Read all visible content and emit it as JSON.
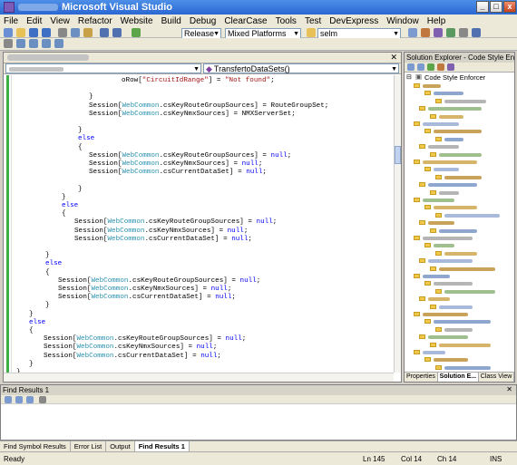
{
  "window": {
    "title": "Microsoft Visual Studio"
  },
  "menu": [
    "File",
    "Edit",
    "View",
    "Refactor",
    "Website",
    "Build",
    "Debug",
    "ClearCase",
    "Tools",
    "Test",
    "DevExpress",
    "Window",
    "Help"
  ],
  "toolbar": {
    "config": "Release",
    "platform": "Mixed Platforms",
    "find_text": "selm"
  },
  "editor": {
    "member_combo": "TransfertoDataSets()"
  },
  "code_lines": [
    {
      "indent": 156,
      "parts": [
        [
          "n",
          "oRow["
        ],
        [
          "s",
          "\"CircuitIdRange\""
        ],
        [
          "n",
          "] = "
        ],
        [
          "s",
          "\"Not found\""
        ],
        [
          "n",
          ";"
        ]
      ]
    },
    {
      "indent": 120,
      "parts": [
        [
          "n",
          ""
        ]
      ]
    },
    {
      "indent": 120,
      "parts": [
        [
          "n",
          "}"
        ]
      ]
    },
    {
      "indent": 120,
      "parts": [
        [
          "n",
          "Session["
        ],
        [
          "t",
          "WebCommon"
        ],
        [
          "n",
          ".csKeyRouteGroupSources] = RouteGroupSet;"
        ]
      ]
    },
    {
      "indent": 120,
      "parts": [
        [
          "n",
          "Session["
        ],
        [
          "t",
          "WebCommon"
        ],
        [
          "n",
          ".csKeyNmxSources] = NMXServerSet;"
        ]
      ]
    },
    {
      "indent": 120,
      "parts": [
        [
          "n",
          ""
        ]
      ]
    },
    {
      "indent": 108,
      "parts": [
        [
          "n",
          "}"
        ]
      ]
    },
    {
      "indent": 108,
      "parts": [
        [
          "k",
          "else"
        ]
      ]
    },
    {
      "indent": 108,
      "parts": [
        [
          "n",
          "{"
        ]
      ]
    },
    {
      "indent": 120,
      "parts": [
        [
          "n",
          "Session["
        ],
        [
          "t",
          "WebCommon"
        ],
        [
          "n",
          ".csKeyRouteGroupSources] = "
        ],
        [
          "k",
          "null"
        ],
        [
          "n",
          ";"
        ]
      ]
    },
    {
      "indent": 120,
      "parts": [
        [
          "n",
          "Session["
        ],
        [
          "t",
          "WebCommon"
        ],
        [
          "n",
          ".csKeyNmxSources] = "
        ],
        [
          "k",
          "null"
        ],
        [
          "n",
          ";"
        ]
      ]
    },
    {
      "indent": 120,
      "parts": [
        [
          "n",
          "Session["
        ],
        [
          "t",
          "WebCommon"
        ],
        [
          "n",
          ".csCurrentDataSet] = "
        ],
        [
          "k",
          "null"
        ],
        [
          "n",
          ";"
        ]
      ]
    },
    {
      "indent": 120,
      "parts": [
        [
          "n",
          ""
        ]
      ]
    },
    {
      "indent": 108,
      "parts": [
        [
          "n",
          "}"
        ]
      ]
    },
    {
      "indent": 90,
      "parts": [
        [
          "n",
          "}"
        ]
      ]
    },
    {
      "indent": 90,
      "parts": [
        [
          "k",
          "else"
        ]
      ]
    },
    {
      "indent": 90,
      "parts": [
        [
          "n",
          "{"
        ]
      ]
    },
    {
      "indent": 104,
      "parts": [
        [
          "n",
          "Session["
        ],
        [
          "t",
          "WebCommon"
        ],
        [
          "n",
          ".csKeyRouteGroupSources] = "
        ],
        [
          "k",
          "null"
        ],
        [
          "n",
          ";"
        ]
      ]
    },
    {
      "indent": 104,
      "parts": [
        [
          "n",
          "Session["
        ],
        [
          "t",
          "WebCommon"
        ],
        [
          "n",
          ".csKeyNmxSources] = "
        ],
        [
          "k",
          "null"
        ],
        [
          "n",
          ";"
        ]
      ]
    },
    {
      "indent": 104,
      "parts": [
        [
          "n",
          "Session["
        ],
        [
          "t",
          "WebCommon"
        ],
        [
          "n",
          ".csCurrentDataSet] = "
        ],
        [
          "k",
          "null"
        ],
        [
          "n",
          ";"
        ]
      ]
    },
    {
      "indent": 90,
      "parts": [
        [
          "n",
          ""
        ]
      ]
    },
    {
      "indent": 72,
      "parts": [
        [
          "n",
          "}"
        ]
      ]
    },
    {
      "indent": 72,
      "parts": [
        [
          "k",
          "else"
        ]
      ]
    },
    {
      "indent": 72,
      "parts": [
        [
          "n",
          "{"
        ]
      ]
    },
    {
      "indent": 86,
      "parts": [
        [
          "n",
          "Session["
        ],
        [
          "t",
          "WebCommon"
        ],
        [
          "n",
          ".csKeyRouteGroupSources] = "
        ],
        [
          "k",
          "null"
        ],
        [
          "n",
          ";"
        ]
      ]
    },
    {
      "indent": 86,
      "parts": [
        [
          "n",
          "Session["
        ],
        [
          "t",
          "WebCommon"
        ],
        [
          "n",
          ".csKeyNmxSources] = "
        ],
        [
          "k",
          "null"
        ],
        [
          "n",
          ";"
        ]
      ]
    },
    {
      "indent": 86,
      "parts": [
        [
          "n",
          "Session["
        ],
        [
          "t",
          "WebCommon"
        ],
        [
          "n",
          ".csCurrentDataSet] = "
        ],
        [
          "k",
          "null"
        ],
        [
          "n",
          ";"
        ]
      ]
    },
    {
      "indent": 72,
      "parts": [
        [
          "n",
          "}"
        ]
      ]
    },
    {
      "indent": 54,
      "parts": [
        [
          "n",
          "}"
        ]
      ]
    },
    {
      "indent": 54,
      "parts": [
        [
          "k",
          "else"
        ]
      ]
    },
    {
      "indent": 54,
      "parts": [
        [
          "n",
          "{"
        ]
      ]
    },
    {
      "indent": 70,
      "parts": [
        [
          "n",
          "Session["
        ],
        [
          "t",
          "WebCommon"
        ],
        [
          "n",
          ".csKeyRouteGroupSources] = "
        ],
        [
          "k",
          "null"
        ],
        [
          "n",
          ";"
        ]
      ]
    },
    {
      "indent": 70,
      "parts": [
        [
          "n",
          "Session["
        ],
        [
          "t",
          "WebCommon"
        ],
        [
          "n",
          ".csKeyNmxSources] = "
        ],
        [
          "k",
          "null"
        ],
        [
          "n",
          ";"
        ]
      ]
    },
    {
      "indent": 70,
      "parts": [
        [
          "n",
          "Session["
        ],
        [
          "t",
          "WebCommon"
        ],
        [
          "n",
          ".csCurrentDataSet] = "
        ],
        [
          "k",
          "null"
        ],
        [
          "n",
          ";"
        ]
      ]
    },
    {
      "indent": 54,
      "parts": [
        [
          "n",
          "}"
        ]
      ]
    },
    {
      "indent": 40,
      "parts": [
        [
          "n",
          "}"
        ]
      ]
    }
  ],
  "solution_explorer": {
    "title": "Solution Explorer - Code Style Enf...",
    "root": "Code Style Enforcer",
    "tabs": [
      "Properties",
      "Solution E...",
      "Class View"
    ]
  },
  "find_results": {
    "title": "Find Results 1"
  },
  "bottom_tabs": [
    "Find Symbol Results",
    "Error List",
    "Output",
    "Find Results 1"
  ],
  "status": {
    "text": "Ready",
    "ln": "Ln 145",
    "col": "Col 14",
    "ch": "Ch 14",
    "mode": "INS"
  },
  "colors": {
    "keyword": "#0000ff",
    "type": "#2b91af",
    "string": "#a31515",
    "titlebar": "#2a67d3"
  }
}
